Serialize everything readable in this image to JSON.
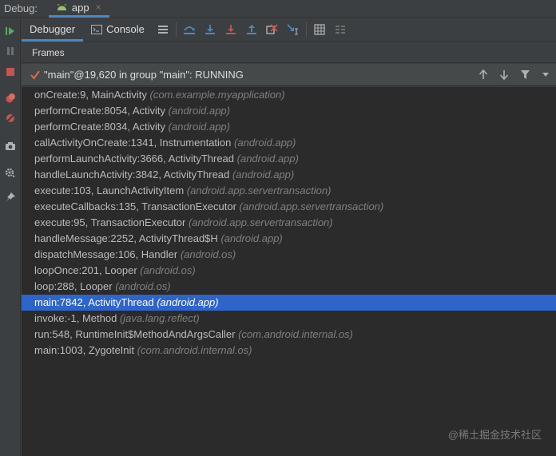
{
  "titlebar": {
    "label": "Debug:",
    "tab_label": "app",
    "close_glyph": "×"
  },
  "toolbar": {
    "tabs": [
      {
        "label": "Debugger",
        "active": true
      },
      {
        "label": "Console",
        "active": false
      }
    ]
  },
  "frames_header": "Frames",
  "thread": {
    "label": "\"main\"@19,620 in group \"main\": RUNNING"
  },
  "frames": [
    {
      "method": "onCreate:9, MainActivity",
      "pkg": "(com.example.myapplication)"
    },
    {
      "method": "performCreate:8054, Activity",
      "pkg": "(android.app)"
    },
    {
      "method": "performCreate:8034, Activity",
      "pkg": "(android.app)"
    },
    {
      "method": "callActivityOnCreate:1341, Instrumentation",
      "pkg": "(android.app)"
    },
    {
      "method": "performLaunchActivity:3666, ActivityThread",
      "pkg": "(android.app)"
    },
    {
      "method": "handleLaunchActivity:3842, ActivityThread",
      "pkg": "(android.app)"
    },
    {
      "method": "execute:103, LaunchActivityItem",
      "pkg": "(android.app.servertransaction)"
    },
    {
      "method": "executeCallbacks:135, TransactionExecutor",
      "pkg": "(android.app.servertransaction)"
    },
    {
      "method": "execute:95, TransactionExecutor",
      "pkg": "(android.app.servertransaction)"
    },
    {
      "method": "handleMessage:2252, ActivityThread$H",
      "pkg": "(android.app)"
    },
    {
      "method": "dispatchMessage:106, Handler",
      "pkg": "(android.os)"
    },
    {
      "method": "loopOnce:201, Looper",
      "pkg": "(android.os)"
    },
    {
      "method": "loop:288, Looper",
      "pkg": "(android.os)"
    },
    {
      "method": "main:7842, ActivityThread",
      "pkg": "(android.app)",
      "selected": true
    },
    {
      "method": "invoke:-1, Method",
      "pkg": "(java.lang.reflect)"
    },
    {
      "method": "run:548, RuntimeInit$MethodAndArgsCaller",
      "pkg": "(com.android.internal.os)"
    },
    {
      "method": "main:1003, ZygoteInit",
      "pkg": "(com.android.internal.os)"
    }
  ],
  "watermark": "@稀土掘金技术社区",
  "colors": {
    "accent": "#4a88c7",
    "selection": "#2f65ca",
    "resume_green": "#59a869",
    "stop_red": "#c75450"
  }
}
